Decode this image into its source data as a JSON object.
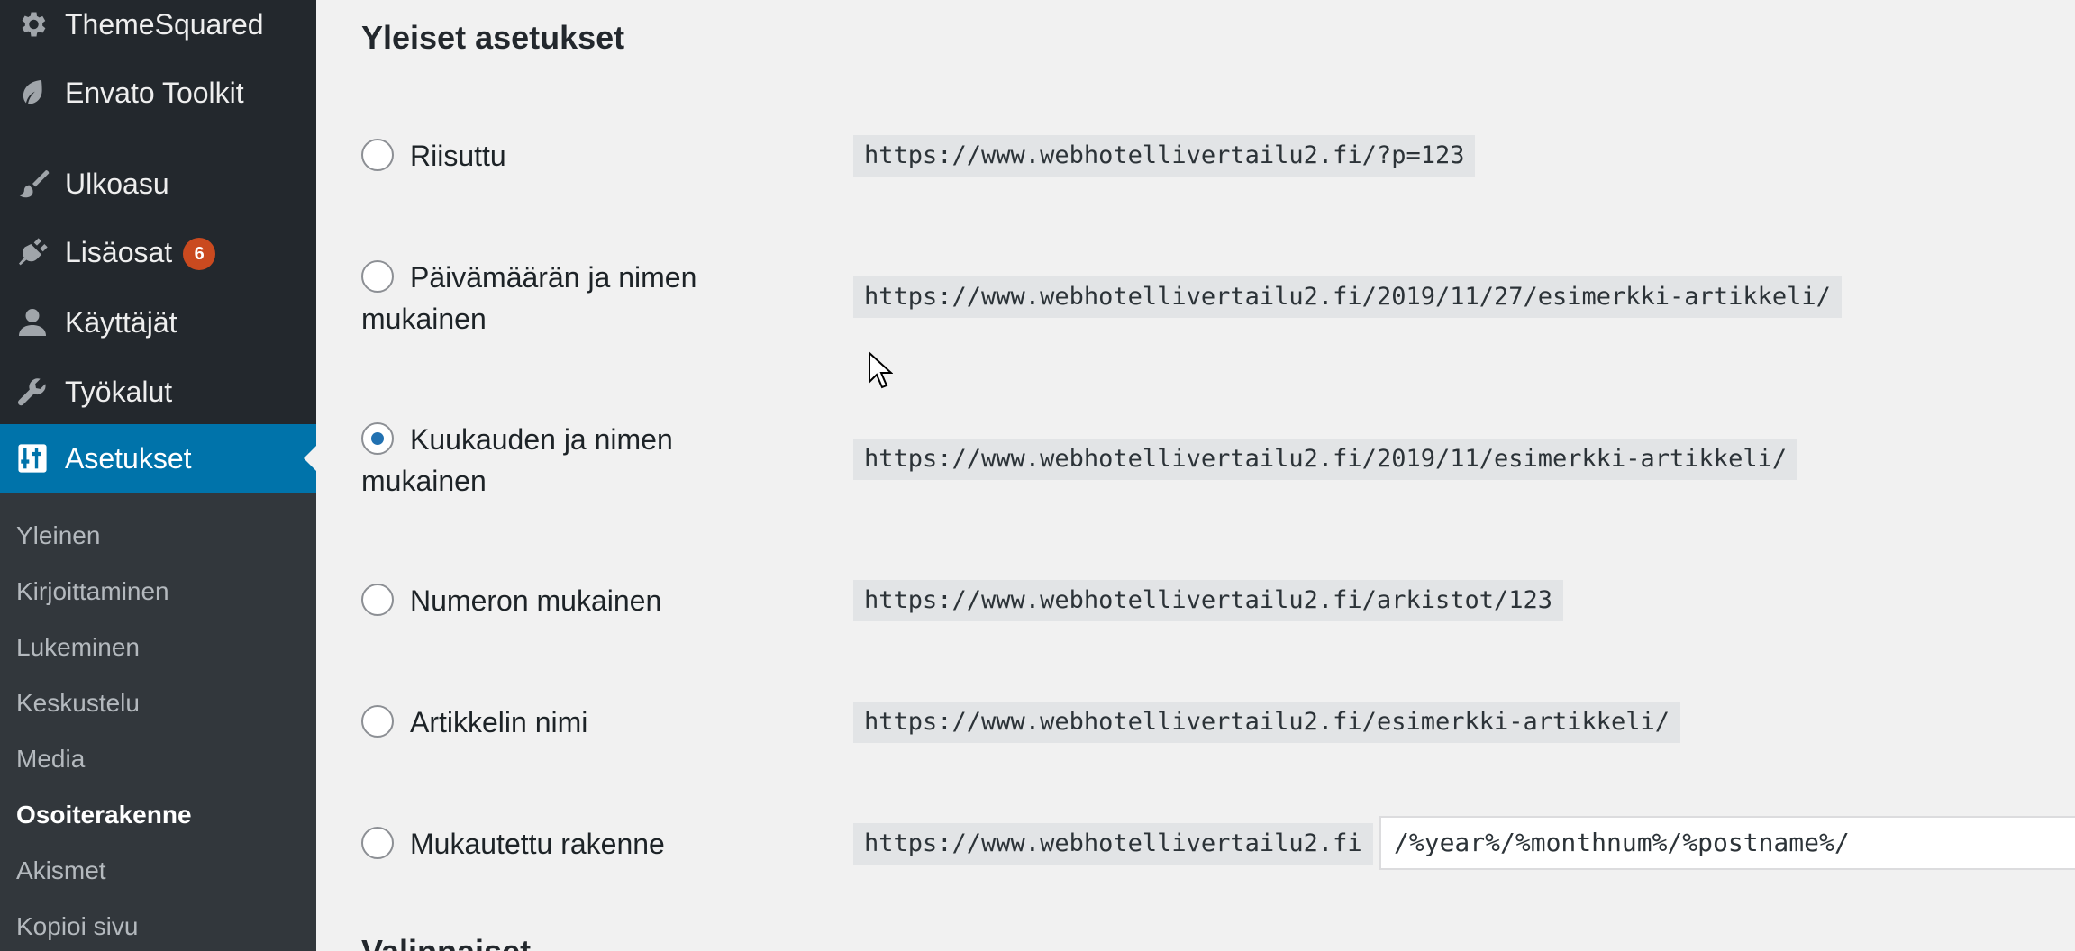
{
  "sidebar": {
    "items": [
      {
        "label": "ThemeSquared",
        "icon": "gear-icon"
      },
      {
        "label": "Envato Toolkit",
        "icon": "leaf-icon"
      },
      {
        "label": "Ulkoasu",
        "icon": "brush-icon"
      },
      {
        "label": "Lisäosat",
        "icon": "plug-icon",
        "badge": "6"
      },
      {
        "label": "Käyttäjät",
        "icon": "user-icon"
      },
      {
        "label": "Työkalut",
        "icon": "wrench-icon"
      },
      {
        "label": "Asetukset",
        "icon": "settings-icon",
        "active": true
      }
    ],
    "submenu": [
      {
        "label": "Yleinen"
      },
      {
        "label": "Kirjoittaminen"
      },
      {
        "label": "Lukeminen"
      },
      {
        "label": "Keskustelu"
      },
      {
        "label": "Media"
      },
      {
        "label": "Osoiterakenne",
        "current": true
      },
      {
        "label": "Akismet"
      },
      {
        "label": "Kopioi sivu"
      }
    ]
  },
  "main": {
    "section_title": "Yleiset asetukset",
    "next_section_title": "Valinnaiset",
    "options": [
      {
        "label": "Riisuttu",
        "example": "https://www.webhotellivertailu2.fi/?p=123",
        "checked": false
      },
      {
        "label": "Päivämäärän ja nimen mukainen",
        "example": "https://www.webhotellivertailu2.fi/2019/11/27/esimerkki-artikkeli/",
        "checked": false
      },
      {
        "label": "Kuukauden ja nimen mukainen",
        "example": "https://www.webhotellivertailu2.fi/2019/11/esimerkki-artikkeli/",
        "checked": true
      },
      {
        "label": "Numeron mukainen",
        "example": "https://www.webhotellivertailu2.fi/arkistot/123",
        "checked": false
      },
      {
        "label": "Artikkelin nimi",
        "example": "https://www.webhotellivertailu2.fi/esimerkki-artikkeli/",
        "checked": false
      },
      {
        "label": "Mukautettu rakenne",
        "example": "https://www.webhotellivertailu2.fi",
        "checked": false,
        "custom_value": "/%year%/%monthnum%/%postname%/"
      }
    ]
  },
  "colors": {
    "sidebar_bg": "#23282d",
    "submenu_bg": "#32373c",
    "active_bg": "#0073aa",
    "badge_bg": "#ca4a1f",
    "radio_checked": "#2271b1"
  }
}
